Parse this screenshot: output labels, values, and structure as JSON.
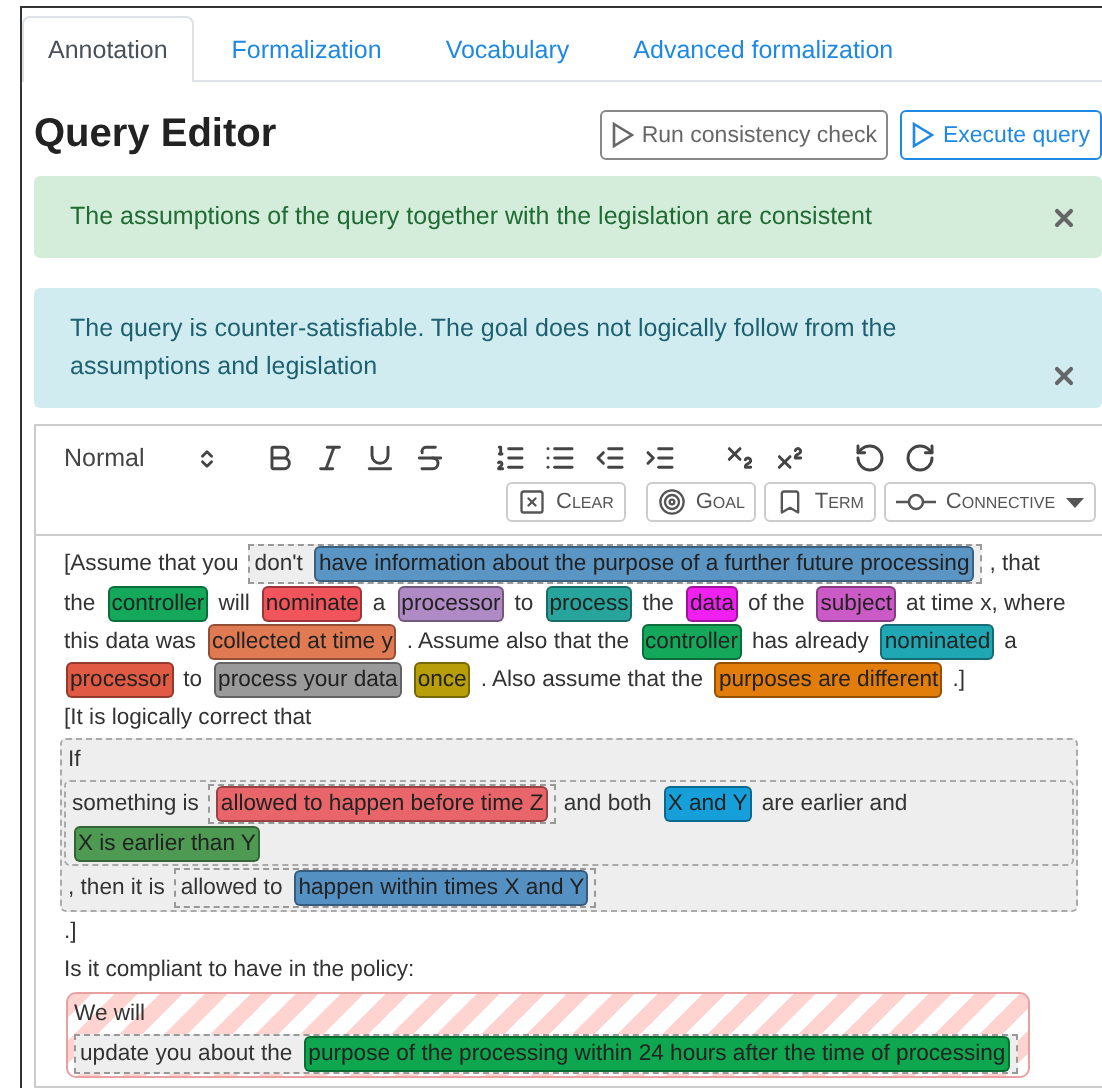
{
  "tabs": [
    {
      "label": "Annotation",
      "selected": true
    },
    {
      "label": "Formalization",
      "selected": false
    },
    {
      "label": "Vocabulary",
      "selected": false
    },
    {
      "label": "Advanced formalization",
      "selected": false
    }
  ],
  "title": "Query Editor",
  "actions": [
    {
      "label": "Run consistency check",
      "kind": "secondary"
    },
    {
      "label": "Execute query",
      "kind": "primary"
    }
  ],
  "alerts": [
    {
      "kind": "success",
      "text": "The assumptions of the query together with the legislation are consistent"
    },
    {
      "kind": "info",
      "text": "The query is counter-satisfiable. The goal does not logically follow from the assumptions and legislation"
    }
  ],
  "toolbar": {
    "format": "Normal",
    "buttons": [
      {
        "label": "Clear",
        "kind": "clear"
      },
      {
        "label": "Goal",
        "kind": "goal"
      },
      {
        "label": "Term",
        "kind": "term"
      },
      {
        "label": "Connective",
        "kind": "connective"
      }
    ]
  },
  "editor": {
    "content": [
      {
        "kind": "line",
        "segments": [
          {
            "kind": "text",
            "text": "[Assume that you"
          },
          {
            "kind": "group",
            "segments": [
              {
                "kind": "text",
                "text": "don't"
              },
              {
                "kind": "tag",
                "text": "have information about the purpose of a further future processing",
                "color": "#5b95c4"
              }
            ]
          },
          {
            "kind": "text",
            "text": ", that"
          }
        ]
      },
      {
        "kind": "line",
        "segments": [
          {
            "kind": "text",
            "text": "the"
          },
          {
            "kind": "tag",
            "text": "controller",
            "color": "#13a85a"
          },
          {
            "kind": "text",
            "text": "will"
          },
          {
            "kind": "tag",
            "text": "nominate",
            "color": "#f2545b"
          },
          {
            "kind": "text",
            "text": "a"
          },
          {
            "kind": "tag",
            "text": "processor",
            "color": "#b08ac4"
          },
          {
            "kind": "text",
            "text": "to"
          },
          {
            "kind": "tag",
            "text": "process",
            "color": "#27a59c"
          },
          {
            "kind": "text",
            "text": "the"
          },
          {
            "kind": "tag",
            "text": "data",
            "color": "#f020f0"
          },
          {
            "kind": "text",
            "text": "of the"
          },
          {
            "kind": "tag",
            "text": "subject",
            "color": "#cc5ac6"
          },
          {
            "kind": "text",
            "text": "at time x, where"
          }
        ]
      },
      {
        "kind": "line",
        "segments": [
          {
            "kind": "text",
            "text": "this data was"
          },
          {
            "kind": "tag",
            "text": "collected at time y",
            "color": "#e07a52"
          },
          {
            "kind": "text",
            "text": ". Assume also that the"
          },
          {
            "kind": "tag",
            "text": "controller",
            "color": "#13a85a"
          },
          {
            "kind": "text",
            "text": "has already"
          },
          {
            "kind": "tag",
            "text": "nominated",
            "color": "#1fa8b4"
          },
          {
            "kind": "text",
            "text": "a"
          }
        ]
      },
      {
        "kind": "line",
        "segments": [
          {
            "kind": "tag",
            "text": "processor",
            "color": "#e05a44"
          },
          {
            "kind": "text",
            "text": "to"
          },
          {
            "kind": "tag",
            "text": "process your data",
            "color": "#9a9a9a"
          },
          {
            "kind": "tag",
            "text": "once",
            "color": "#b89e08"
          },
          {
            "kind": "text",
            "text": ". Also assume that the"
          },
          {
            "kind": "tag",
            "text": "purposes are different",
            "color": "#e27c0a"
          },
          {
            "kind": "text",
            "text": ".]"
          }
        ]
      },
      {
        "kind": "line",
        "segments": [
          {
            "kind": "text",
            "text": "[It is logically correct that"
          }
        ]
      },
      {
        "kind": "dashed-block",
        "children": [
          {
            "kind": "line",
            "segments": [
              {
                "kind": "text",
                "text": "If"
              }
            ]
          },
          {
            "kind": "dashed-block",
            "children": [
              {
                "kind": "line",
                "segments": [
                  {
                    "kind": "text",
                    "text": "something is"
                  },
                  {
                    "kind": "group",
                    "segments": [
                      {
                        "kind": "tag",
                        "text": "allowed to happen before time Z",
                        "color": "#e8666a"
                      }
                    ]
                  },
                  {
                    "kind": "text",
                    "text": "and both"
                  },
                  {
                    "kind": "tag",
                    "text": "X and Y",
                    "color": "#169fd8"
                  },
                  {
                    "kind": "text",
                    "text": "are earlier and"
                  }
                ]
              },
              {
                "kind": "line",
                "segments": [
                  {
                    "kind": "tag",
                    "text": "X is earlier than Y",
                    "color": "#4e9a52"
                  }
                ]
              }
            ]
          },
          {
            "kind": "line",
            "segments": [
              {
                "kind": "text",
                "text": ", then it is"
              },
              {
                "kind": "group",
                "segments": [
                  {
                    "kind": "text",
                    "text": "allowed to"
                  },
                  {
                    "kind": "tag",
                    "text": "happen within times X and Y",
                    "color": "#5590c2"
                  }
                ]
              }
            ]
          }
        ]
      },
      {
        "kind": "line",
        "segments": [
          {
            "kind": "text",
            "text": ".]"
          }
        ]
      },
      {
        "kind": "line",
        "segments": [
          {
            "kind": "text",
            "text": "Is it compliant to have in the policy:"
          }
        ]
      },
      {
        "kind": "striped-block",
        "children": [
          {
            "kind": "line",
            "segments": [
              {
                "kind": "text",
                "text": "We will"
              }
            ]
          },
          {
            "kind": "line",
            "segments": [
              {
                "kind": "group",
                "segments": [
                  {
                    "kind": "text",
                    "text": "update you about the"
                  },
                  {
                    "kind": "tag",
                    "text": "purpose of the processing within 24 hours after the time of processing",
                    "color": "#0ea64e"
                  }
                ]
              }
            ]
          }
        ]
      }
    ]
  }
}
